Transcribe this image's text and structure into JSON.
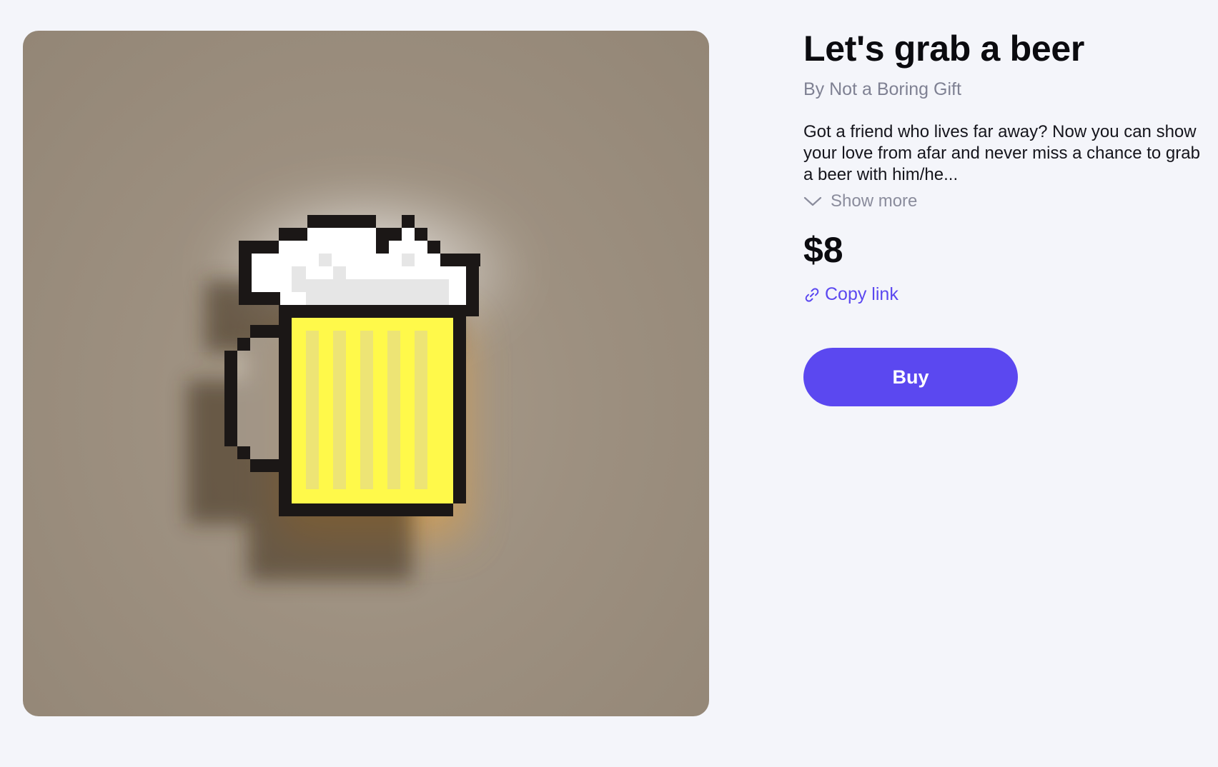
{
  "product": {
    "title": "Let's grab a beer",
    "author": "By Not a Boring Gift",
    "description": "Got a friend who lives far away? Now you can show your love from afar and never miss a chance to grab a beer with him/he...",
    "show_more_label": "Show more",
    "price": "$8",
    "copy_link_label": "Copy link",
    "buy_label": "Buy",
    "image_icon": "pixel-beer-mug-image"
  },
  "colors": {
    "accent": "#5b48f0",
    "background": "#f4f5fa",
    "image_background": "#9d9080",
    "beer_yellow": "#fff94a",
    "foam_white": "#ffffff"
  }
}
